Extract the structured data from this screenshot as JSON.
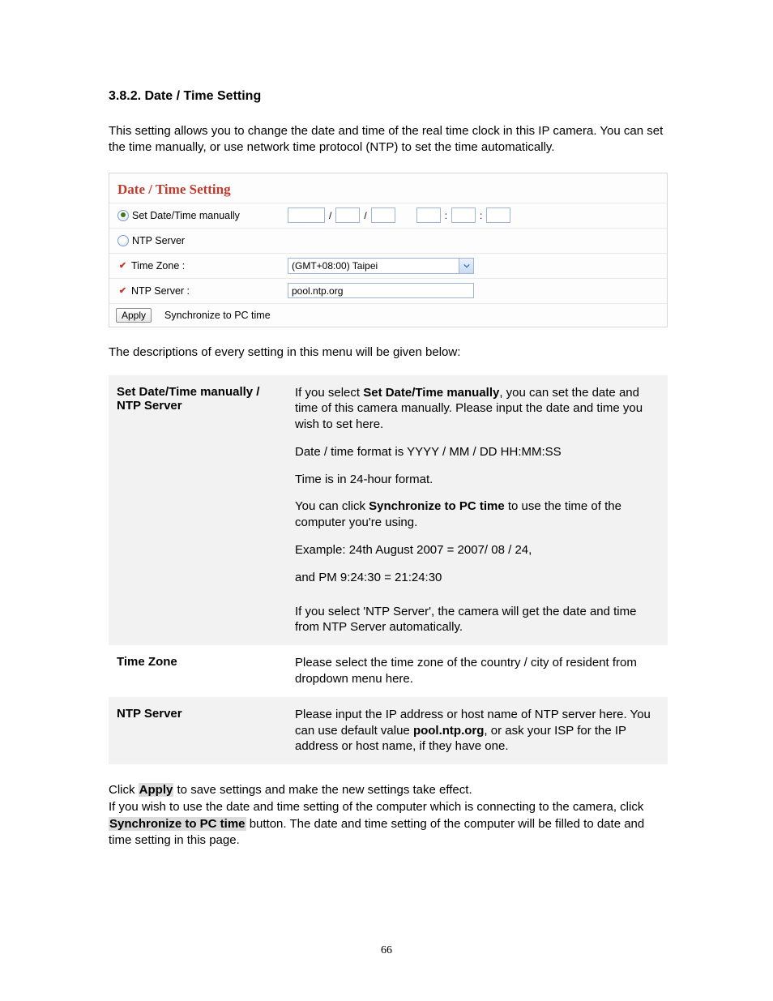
{
  "heading": "3.8.2.  Date / Time Setting",
  "intro": "This setting allows you to change the date and time of the real time clock in this IP camera. You can set the time manually, or use network time protocol (NTP) to set the time automatically.",
  "panel": {
    "title": "Date / Time Setting",
    "set_manual_label": "Set Date/Time manually",
    "ntp_radio_label": "NTP Server",
    "timezone_label": "Time Zone :",
    "ntp_server_label": "NTP Server :",
    "slash": "/",
    "colon": ":",
    "timezone_value": "(GMT+08:00) Taipei",
    "ntp_server_value": "pool.ntp.org",
    "apply_btn": "Apply",
    "sync_btn": "Synchronize to PC time"
  },
  "desc_intro": "The descriptions of every setting in this menu will be given below:",
  "rows": {
    "r1": {
      "label": "Set Date/Time manually / NTP Server",
      "p1a": "If you select ",
      "p1b": "Set Date/Time manually",
      "p1c": ", you can set the date and time of this camera manually. Please input the date and time you wish to set here.",
      "p2": "Date / time format is YYYY / MM / DD   HH:MM:SS",
      "p3": "Time is in 24-hour format.",
      "p4a": "You can click ",
      "p4b": "Synchronize to PC time",
      "p4c": " to use the time of the computer you're using.",
      "p5": "Example: 24th August 2007 = 2007/ 08 / 24,",
      "p6": "and PM 9:24:30 = 21:24:30",
      "p7": "If you select 'NTP Server', the camera will get the date and time from NTP Server automatically."
    },
    "r2": {
      "label": "Time Zone",
      "p1": "Please select the time zone of the country / city of resident from dropdown menu here."
    },
    "r3": {
      "label": "NTP Server",
      "p1a": "Please input the IP address or host name of NTP server here. You can use default value ",
      "p1b": "pool.ntp.org",
      "p1c": ", or ask your ISP for the IP address or host name, if they have one."
    }
  },
  "closing": {
    "l1a": "Click ",
    "l1b": "Apply",
    "l1c": " to save settings and make the new settings take effect.",
    "l2a": "If you wish to use the date and time setting of the computer which is connecting to the camera, click ",
    "l2b": "Synchronize to PC time",
    "l2c": " button. The date and time setting of the computer will be filled to date and time setting in this page."
  },
  "page_number": "66"
}
